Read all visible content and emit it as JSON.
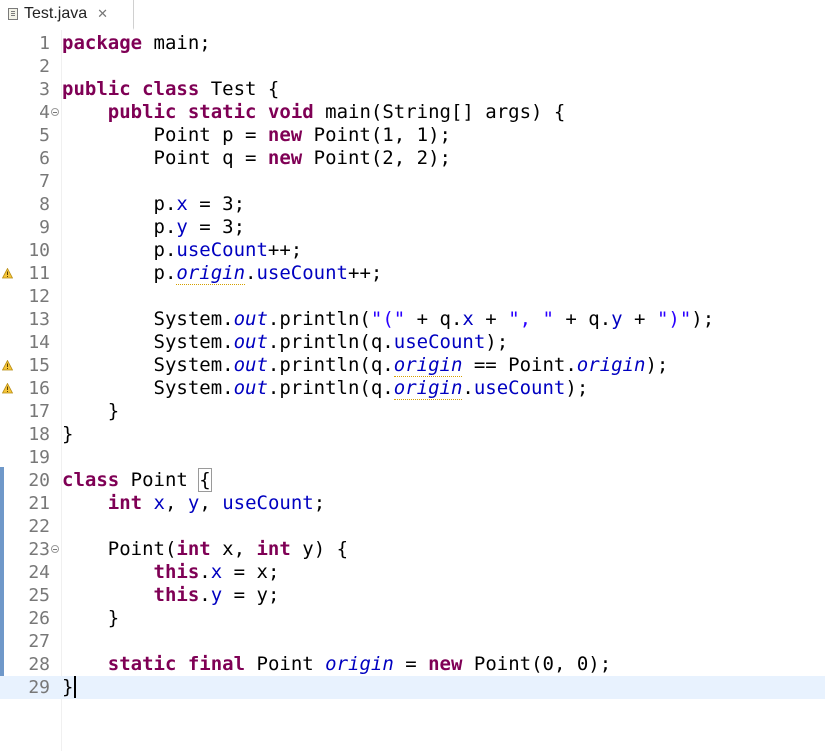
{
  "tab": {
    "title": "Test.java",
    "close_glyph": "✕"
  },
  "lines": [
    {
      "n": "1",
      "tokens": [
        [
          "kw",
          "package"
        ],
        [
          "t",
          " main;"
        ]
      ]
    },
    {
      "n": "2",
      "tokens": []
    },
    {
      "n": "3",
      "tokens": [
        [
          "kw",
          "public"
        ],
        [
          "t",
          " "
        ],
        [
          "kw",
          "class"
        ],
        [
          "t",
          " Test {"
        ]
      ]
    },
    {
      "n": "4",
      "fold": true,
      "tokens": [
        [
          "t",
          "    "
        ],
        [
          "kw",
          "public"
        ],
        [
          "t",
          " "
        ],
        [
          "kw",
          "static"
        ],
        [
          "t",
          " "
        ],
        [
          "kw",
          "void"
        ],
        [
          "t",
          " main(String[] args) {"
        ]
      ]
    },
    {
      "n": "5",
      "tokens": [
        [
          "t",
          "        Point p = "
        ],
        [
          "kw",
          "new"
        ],
        [
          "t",
          " Point(1, 1);"
        ]
      ]
    },
    {
      "n": "6",
      "tokens": [
        [
          "t",
          "        Point q = "
        ],
        [
          "kw",
          "new"
        ],
        [
          "t",
          " Point(2, 2);"
        ]
      ]
    },
    {
      "n": "7",
      "tokens": []
    },
    {
      "n": "8",
      "tokens": [
        [
          "t",
          "        p."
        ],
        [
          "fld",
          "x"
        ],
        [
          "t",
          " = 3;"
        ]
      ]
    },
    {
      "n": "9",
      "tokens": [
        [
          "t",
          "        p."
        ],
        [
          "fld",
          "y"
        ],
        [
          "t",
          " = 3;"
        ]
      ]
    },
    {
      "n": "10",
      "tokens": [
        [
          "t",
          "        p."
        ],
        [
          "fld",
          "useCount"
        ],
        [
          "t",
          "++;"
        ]
      ]
    },
    {
      "n": "11",
      "warn": true,
      "tokens": [
        [
          "t",
          "        p."
        ],
        [
          "ufld",
          "origin"
        ],
        [
          "t",
          "."
        ],
        [
          "fld",
          "useCount"
        ],
        [
          "t",
          "++;"
        ]
      ]
    },
    {
      "n": "12",
      "tokens": []
    },
    {
      "n": "13",
      "tokens": [
        [
          "t",
          "        System."
        ],
        [
          "sfld",
          "out"
        ],
        [
          "t",
          ".println("
        ],
        [
          "str",
          "\"(\""
        ],
        [
          "t",
          " + q."
        ],
        [
          "fld",
          "x"
        ],
        [
          "t",
          " + "
        ],
        [
          "str",
          "\", \""
        ],
        [
          "t",
          " + q."
        ],
        [
          "fld",
          "y"
        ],
        [
          "t",
          " + "
        ],
        [
          "str",
          "\")\""
        ],
        [
          "t",
          ");"
        ]
      ]
    },
    {
      "n": "14",
      "tokens": [
        [
          "t",
          "        System."
        ],
        [
          "sfld",
          "out"
        ],
        [
          "t",
          ".println(q."
        ],
        [
          "fld",
          "useCount"
        ],
        [
          "t",
          ");"
        ]
      ]
    },
    {
      "n": "15",
      "warn": true,
      "tokens": [
        [
          "t",
          "        System."
        ],
        [
          "sfld",
          "out"
        ],
        [
          "t",
          ".println(q."
        ],
        [
          "ufld",
          "origin"
        ],
        [
          "t",
          " == Point."
        ],
        [
          "sfld",
          "origin"
        ],
        [
          "t",
          ");"
        ]
      ]
    },
    {
      "n": "16",
      "warn": true,
      "tokens": [
        [
          "t",
          "        System."
        ],
        [
          "sfld",
          "out"
        ],
        [
          "t",
          ".println(q."
        ],
        [
          "ufld",
          "origin"
        ],
        [
          "t",
          "."
        ],
        [
          "fld",
          "useCount"
        ],
        [
          "t",
          ");"
        ]
      ]
    },
    {
      "n": "17",
      "tokens": [
        [
          "t",
          "    }"
        ]
      ]
    },
    {
      "n": "18",
      "tokens": [
        [
          "t",
          "}"
        ]
      ]
    },
    {
      "n": "19",
      "tokens": []
    },
    {
      "n": "20",
      "tokens": [
        [
          "kw",
          "class"
        ],
        [
          "t",
          " Point "
        ],
        [
          "box",
          "{"
        ]
      ]
    },
    {
      "n": "21",
      "tokens": [
        [
          "t",
          "    "
        ],
        [
          "kw",
          "int"
        ],
        [
          "t",
          " "
        ],
        [
          "fld",
          "x"
        ],
        [
          "t",
          ", "
        ],
        [
          "fld",
          "y"
        ],
        [
          "t",
          ", "
        ],
        [
          "fld",
          "useCount"
        ],
        [
          "t",
          ";"
        ]
      ]
    },
    {
      "n": "22",
      "tokens": []
    },
    {
      "n": "23",
      "fold": true,
      "tokens": [
        [
          "t",
          "    Point("
        ],
        [
          "kw",
          "int"
        ],
        [
          "t",
          " x, "
        ],
        [
          "kw",
          "int"
        ],
        [
          "t",
          " y) {"
        ]
      ]
    },
    {
      "n": "24",
      "tokens": [
        [
          "t",
          "        "
        ],
        [
          "kw",
          "this"
        ],
        [
          "t",
          "."
        ],
        [
          "fld",
          "x"
        ],
        [
          "t",
          " = x;"
        ]
      ]
    },
    {
      "n": "25",
      "tokens": [
        [
          "t",
          "        "
        ],
        [
          "kw",
          "this"
        ],
        [
          "t",
          "."
        ],
        [
          "fld",
          "y"
        ],
        [
          "t",
          " = y;"
        ]
      ]
    },
    {
      "n": "26",
      "tokens": [
        [
          "t",
          "    }"
        ]
      ]
    },
    {
      "n": "27",
      "tokens": []
    },
    {
      "n": "28",
      "tokens": [
        [
          "t",
          "    "
        ],
        [
          "kw",
          "static"
        ],
        [
          "t",
          " "
        ],
        [
          "kw",
          "final"
        ],
        [
          "t",
          " Point "
        ],
        [
          "sfld",
          "origin"
        ],
        [
          "t",
          " = "
        ],
        [
          "kw",
          "new"
        ],
        [
          "t",
          " Point(0, 0);"
        ]
      ]
    },
    {
      "n": "29",
      "current": true,
      "tokens": [
        [
          "t",
          "}"
        ],
        [
          "caret",
          ""
        ]
      ]
    }
  ]
}
